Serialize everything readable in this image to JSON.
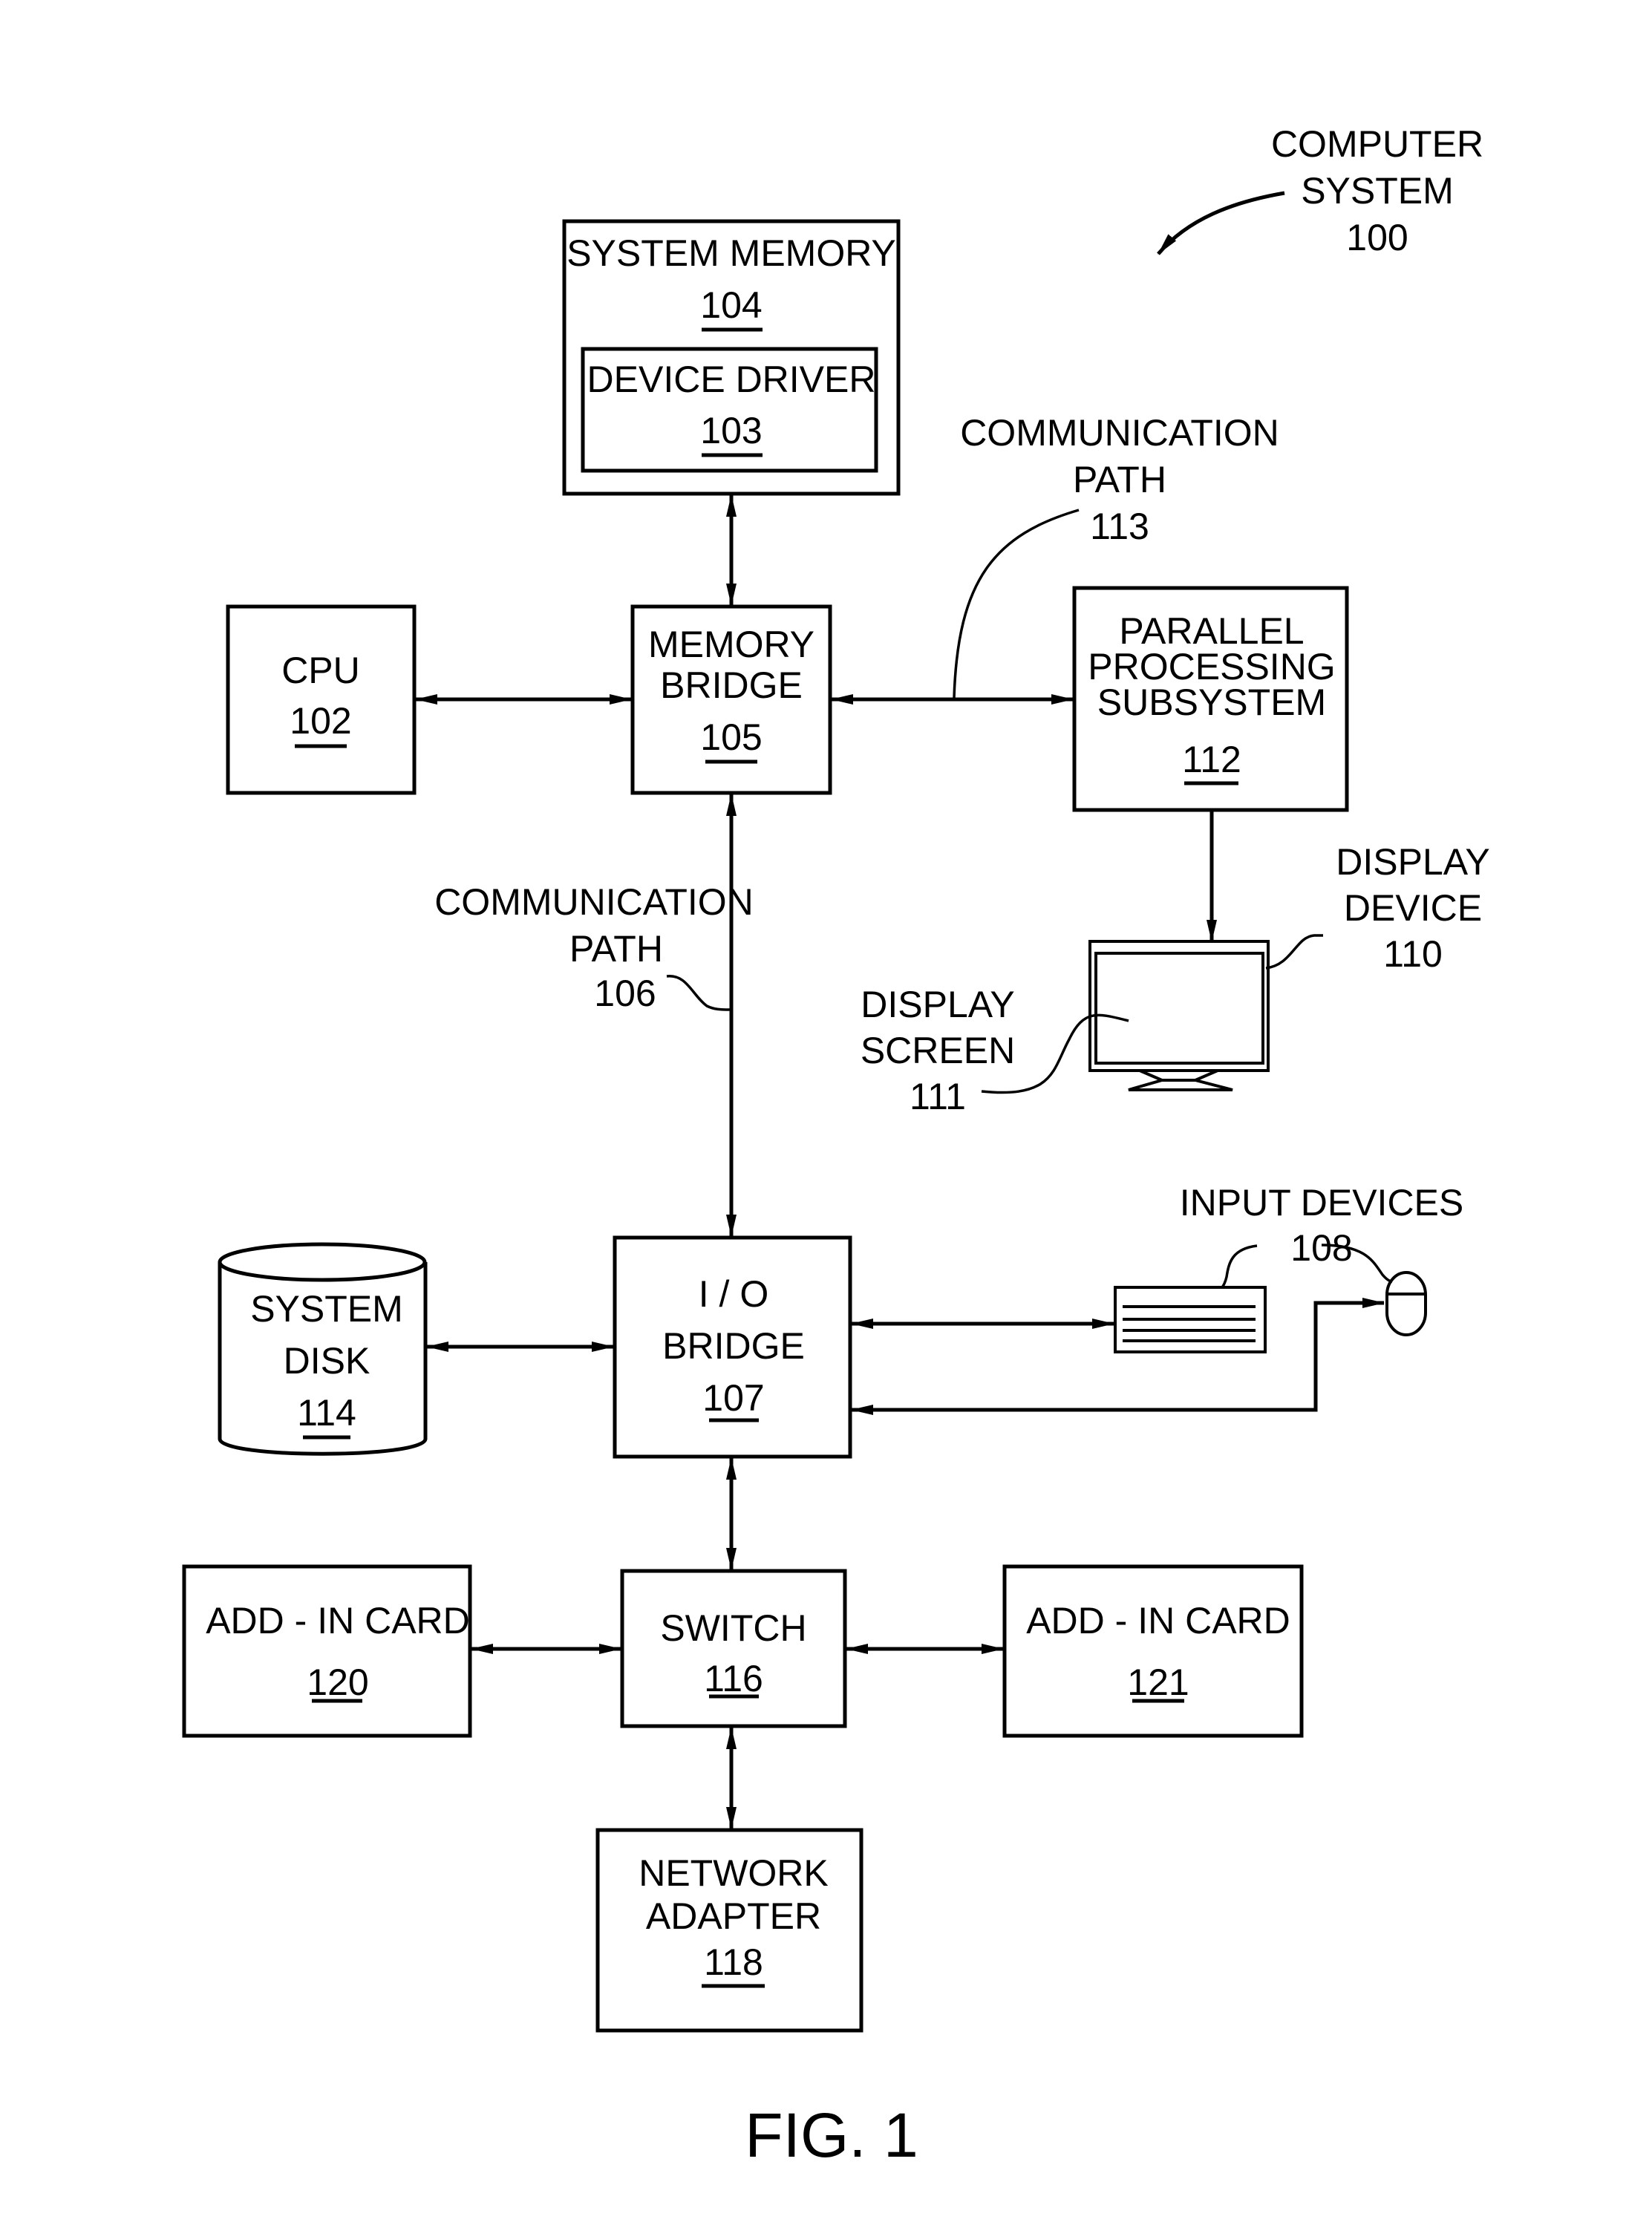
{
  "figure": {
    "caption": "FIG. 1",
    "system_label": {
      "line1": "COMPUTER",
      "line2": "SYSTEM",
      "ref": "100"
    }
  },
  "components": {
    "system_memory": {
      "lines": [
        "SYSTEM MEMORY"
      ],
      "ref": "104"
    },
    "device_driver": {
      "lines": [
        "DEVICE DRIVER"
      ],
      "ref": "103"
    },
    "cpu": {
      "lines": [
        "CPU"
      ],
      "ref": "102"
    },
    "memory_bridge": {
      "lines": [
        "MEMORY",
        "BRIDGE"
      ],
      "ref": "105"
    },
    "parallel_processing_subsystem": {
      "lines": [
        "PARALLEL",
        "PROCESSING",
        "SUBSYSTEM"
      ],
      "ref": "112"
    },
    "io_bridge": {
      "lines": [
        "I / O",
        "BRIDGE"
      ],
      "ref": "107"
    },
    "system_disk": {
      "lines": [
        "SYSTEM",
        "DISK"
      ],
      "ref": "114"
    },
    "switch": {
      "lines": [
        "SWITCH"
      ],
      "ref": "116"
    },
    "add_in_card_left": {
      "lines": [
        "ADD - IN CARD"
      ],
      "ref": "120"
    },
    "add_in_card_right": {
      "lines": [
        "ADD - IN CARD"
      ],
      "ref": "121"
    },
    "network_adapter": {
      "lines": [
        "NETWORK",
        "ADAPTER"
      ],
      "ref": "118"
    }
  },
  "callouts": {
    "comm_path_113": {
      "lines": [
        "COMMUNICATION",
        "PATH"
      ],
      "ref": "113"
    },
    "comm_path_106": {
      "lines": [
        "COMMUNICATION",
        "PATH"
      ],
      "ref": "106"
    },
    "display_device": {
      "lines": [
        "DISPLAY",
        "DEVICE"
      ],
      "ref": "110"
    },
    "display_screen": {
      "lines": [
        "DISPLAY",
        "SCREEN"
      ],
      "ref": "111"
    },
    "input_devices": {
      "lines": [
        "INPUT  DEVICES"
      ],
      "ref": "108"
    }
  },
  "connections": [
    {
      "from": "system_memory",
      "to": "memory_bridge",
      "direction": "bidirectional"
    },
    {
      "from": "cpu",
      "to": "memory_bridge",
      "direction": "bidirectional"
    },
    {
      "from": "memory_bridge",
      "to": "parallel_processing_subsystem",
      "direction": "bidirectional",
      "label_ref": "113"
    },
    {
      "from": "parallel_processing_subsystem",
      "to": "display_device",
      "direction": "forward"
    },
    {
      "from": "memory_bridge",
      "to": "io_bridge",
      "direction": "bidirectional",
      "label_ref": "106"
    },
    {
      "from": "system_disk",
      "to": "io_bridge",
      "direction": "bidirectional"
    },
    {
      "from": "io_bridge",
      "to": "keyboard",
      "direction": "bidirectional"
    },
    {
      "from": "mouse",
      "to": "io_bridge",
      "direction": "bidirectional"
    },
    {
      "from": "io_bridge",
      "to": "switch",
      "direction": "bidirectional"
    },
    {
      "from": "add_in_card_left",
      "to": "switch",
      "direction": "bidirectional"
    },
    {
      "from": "switch",
      "to": "add_in_card_right",
      "direction": "bidirectional"
    },
    {
      "from": "switch",
      "to": "network_adapter",
      "direction": "bidirectional"
    }
  ]
}
